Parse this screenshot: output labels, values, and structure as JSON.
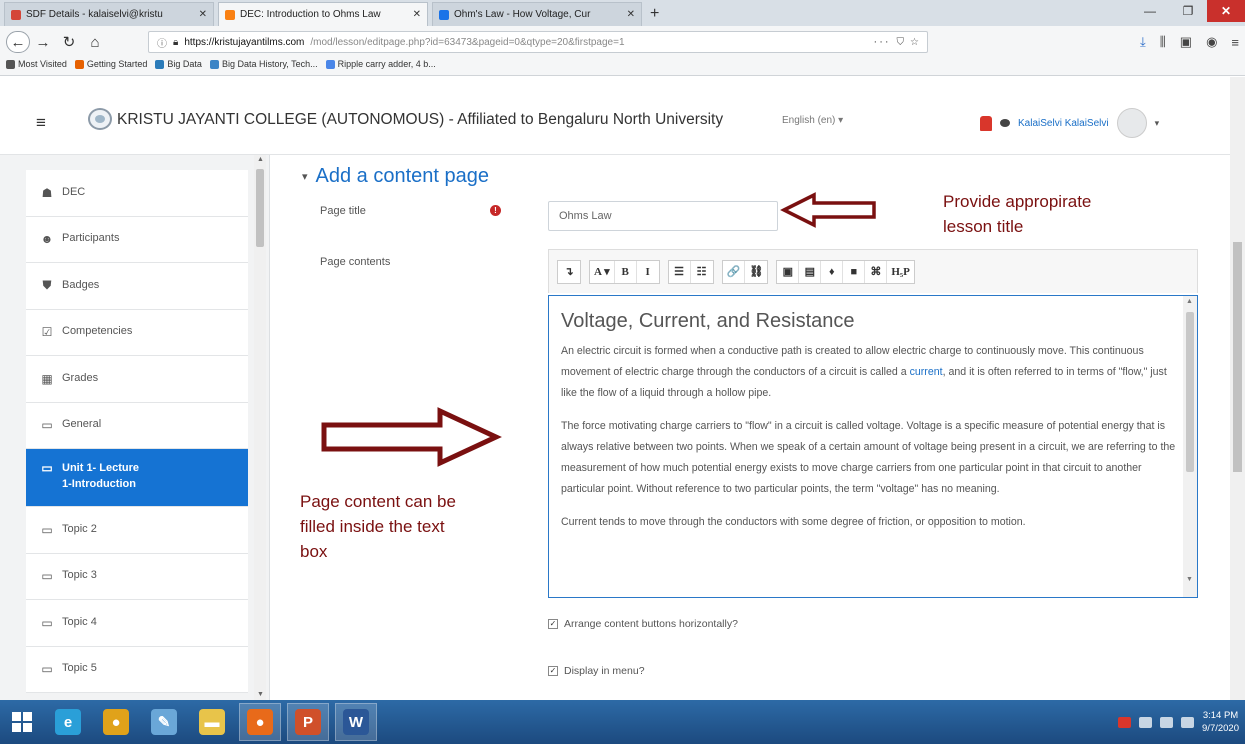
{
  "browser": {
    "tabs": [
      {
        "title": "SDF Details - kalaiselvi@kristu",
        "active": false,
        "icon_color": "#d44638"
      },
      {
        "title": "DEC: Introduction to Ohms Law",
        "active": true,
        "icon_color": "#f98012"
      },
      {
        "title": "Ohm's Law - How Voltage, Cur",
        "active": false,
        "icon_color": "#1a73e8"
      }
    ],
    "new_tab": "+",
    "url_host": "https://kristujayantilms.com",
    "url_path": "/mod/lesson/editpage.php?id=63473&pageid=0&qtype=20&firstpage=1",
    "url_extras": "···",
    "bookmarks": [
      {
        "label": "Most Visited",
        "color": "#555555"
      },
      {
        "label": "Getting Started",
        "color": "#e66000"
      },
      {
        "label": "Big Data",
        "color": "#2b7bb9"
      },
      {
        "label": "Big Data History, Tech...",
        "color": "#3d85c6"
      },
      {
        "label": "Ripple carry adder, 4 b...",
        "color": "#4a86e8"
      }
    ]
  },
  "header": {
    "site_title": "KRISTU JAYANTI COLLEGE (AUTONOMOUS) - Affiliated to Bengaluru North University",
    "language": "English (en) ▾",
    "user_name": "KalaiSelvi KalaiSelvi"
  },
  "drawer": {
    "items": [
      {
        "label": "DEC",
        "icon": "cap-icon",
        "glyph": "☗",
        "active": false
      },
      {
        "label": "Participants",
        "icon": "users-icon",
        "glyph": "☻",
        "active": false
      },
      {
        "label": "Badges",
        "icon": "shield-icon",
        "glyph": "⛊",
        "active": false
      },
      {
        "label": "Competencies",
        "icon": "checklist-icon",
        "glyph": "☑",
        "active": false
      },
      {
        "label": "Grades",
        "icon": "table-icon",
        "glyph": "▦",
        "active": false
      },
      {
        "label": "General",
        "icon": "folder-icon",
        "glyph": "▭",
        "active": false
      },
      {
        "label": "Unit 1- Lecture\n1-Introduction",
        "icon": "folder-icon",
        "glyph": "▭",
        "active": true
      },
      {
        "label": "Topic 2",
        "icon": "folder-icon",
        "glyph": "▭",
        "active": false
      },
      {
        "label": "Topic 3",
        "icon": "folder-icon",
        "glyph": "▭",
        "active": false
      },
      {
        "label": "Topic 4",
        "icon": "folder-icon",
        "glyph": "▭",
        "active": false
      },
      {
        "label": "Topic 5",
        "icon": "folder-icon",
        "glyph": "▭",
        "active": false
      }
    ]
  },
  "form": {
    "section_title": "Add a content page",
    "page_title_label": "Page title",
    "page_title_value": "Ohms Law",
    "page_contents_label": "Page contents",
    "toolbar": [
      [
        "↴"
      ],
      [
        "A ▾",
        "B",
        "I"
      ],
      [
        "☰",
        "☷"
      ],
      [
        "🔗",
        "⛓"
      ],
      [
        "▣",
        "▤",
        "♦",
        "■",
        "⌘",
        "H₅P"
      ]
    ],
    "editor_heading": "Voltage, Current, and Resistance",
    "editor_p1_before": "An electric circuit is formed when a conductive path is created to allow electric charge to continuously move. This continuous movement of electric charge through the conductors of a circuit is called a ",
    "editor_p1_link": "current",
    "editor_p1_after": ", and it is often referred to in terms of \"flow,\" just like the flow of a liquid through a hollow pipe.",
    "editor_p2": "The force motivating charge carriers to \"flow\" in a circuit is called voltage. Voltage is a specific measure of potential energy that is always relative between two points. When we speak of a certain amount of voltage being present in a circuit, we are referring to the measurement of how much potential energy exists to move charge carriers from one particular point in that circuit to another particular point. Without reference to two particular points, the term \"voltage\" has no meaning.",
    "editor_p3": "Current tends to move through the conductors with some degree of friction, or opposition to motion.",
    "checkbox_horizontal": "Arrange content buttons horizontally?",
    "checkbox_menu": "Display in menu?"
  },
  "annotations": {
    "title_note": "Provide appropirate\nlesson title",
    "content_note": "Page content can be\nfilled inside the text\nbox",
    "arrow_color": "#7a1010"
  },
  "taskbar": {
    "apps": [
      {
        "name": "ie-icon",
        "glyph": "e",
        "color": "#2a9fd8"
      },
      {
        "name": "chrome-icon",
        "glyph": "●",
        "color": "#e0a21a"
      },
      {
        "name": "paint-icon",
        "glyph": "✎",
        "color": "#6aa7d8"
      },
      {
        "name": "explorer-icon",
        "glyph": "▬",
        "color": "#e8c44a"
      },
      {
        "name": "firefox-icon",
        "glyph": "●",
        "color": "#e86a1a"
      },
      {
        "name": "powerpoint-icon",
        "glyph": "P",
        "color": "#d0502a"
      },
      {
        "name": "word-icon",
        "glyph": "W",
        "color": "#2b5797"
      }
    ],
    "time": "3:14 PM",
    "date": "9/7/2020"
  }
}
